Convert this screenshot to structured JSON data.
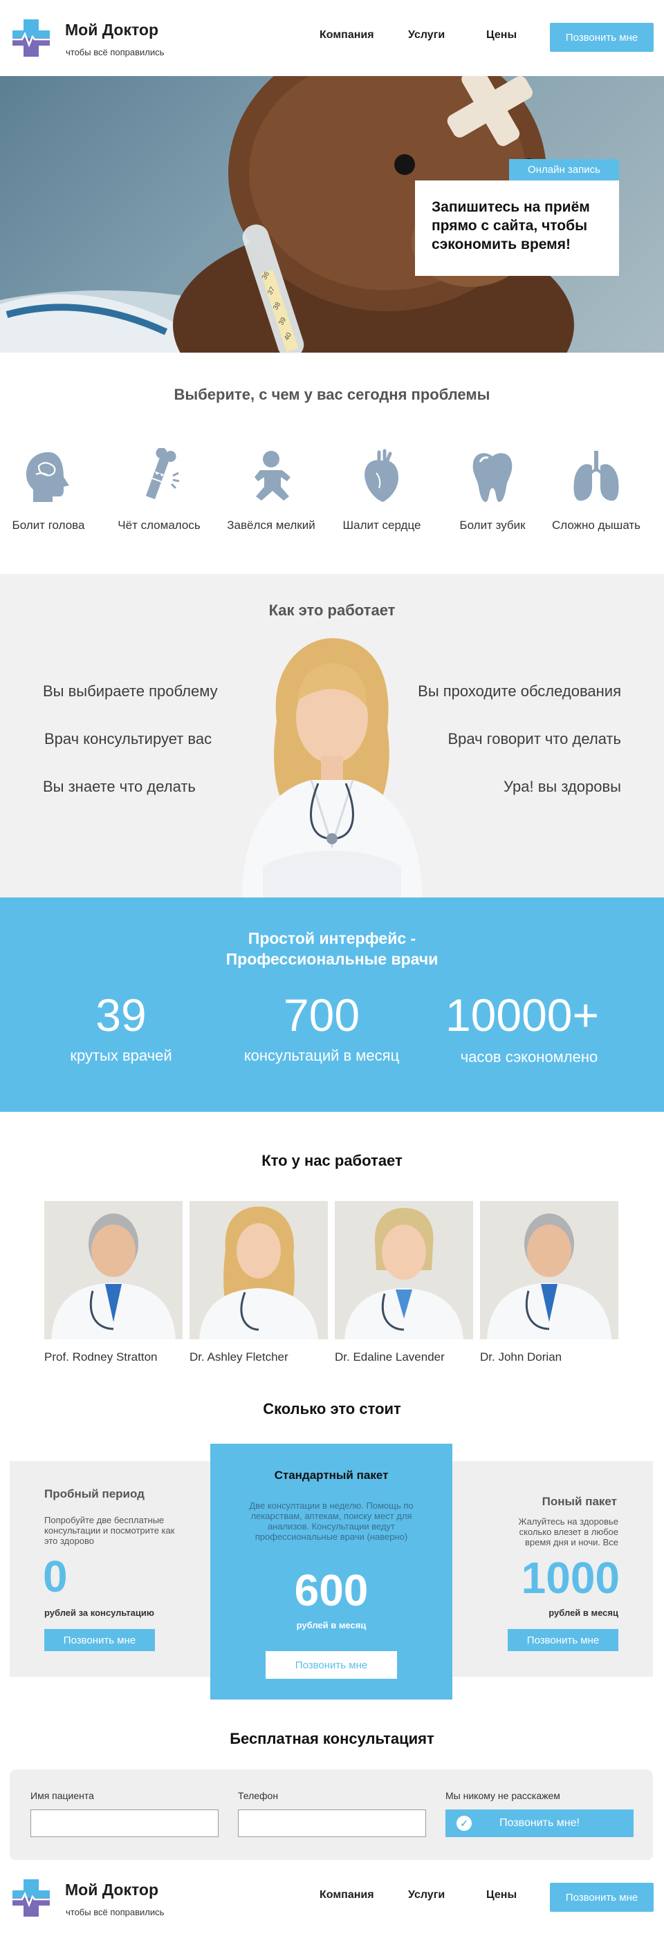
{
  "brand": {
    "name": "Мой Доктор",
    "tagline": "чтобы всё поправились"
  },
  "nav": {
    "items": [
      "Компания",
      "Услуги",
      "Цены"
    ],
    "call_label": "Позвонить мне"
  },
  "hero": {
    "tag": "Онлайн запись",
    "text": "Запишитесь на приём прямо с сайта, чтобы сэкономить время!",
    "thermometer_marks": [
      "36",
      "37",
      "38",
      "39",
      "40"
    ]
  },
  "problems": {
    "title": "Выберите, с чем у вас сегодня проблемы",
    "items": [
      {
        "label": "Болит голова",
        "icon": "head-icon"
      },
      {
        "label": "Чёт сломалось",
        "icon": "broken-bone-icon"
      },
      {
        "label": "Завёлся мелкий",
        "icon": "baby-icon"
      },
      {
        "label": "Шалит сердце",
        "icon": "heart-icon"
      },
      {
        "label": "Болит зубик",
        "icon": "tooth-icon"
      },
      {
        "label": "Сложно дышать",
        "icon": "lungs-icon"
      }
    ]
  },
  "how": {
    "title": "Как это работает",
    "left": [
      "Вы выбираете проблему",
      "Врач консультирует вас",
      "Вы знаете что делать"
    ],
    "right": [
      "Вы проходите обследования",
      "Врач говорит что делать",
      "Ура! вы здоровы"
    ]
  },
  "stats": {
    "title_line1": "Простой интерфейс -",
    "title_line2": "Профессиональные врачи",
    "items": [
      {
        "value": "39",
        "caption": "крутых врачей"
      },
      {
        "value": "700",
        "caption": "консультаций в месяц"
      },
      {
        "value": "10000+",
        "caption": "часов сэкономлено"
      }
    ]
  },
  "team": {
    "title": "Кто у нас работает",
    "doctors": [
      "Prof. Rodney Stratton",
      "Dr. Ashley Fletcher",
      "Dr. Edaline Lavender",
      "Dr. John Dorian"
    ]
  },
  "pricing": {
    "title": "Сколько это стоит",
    "plans": [
      {
        "name": "Пробный период",
        "desc": "Попробуйте две бесплатные консультации и посмотрите как это здорово",
        "price": "0",
        "unit": "рублей за консультацию",
        "button": "Позвонить мне"
      },
      {
        "name": "Стандартный пакет",
        "desc": "Две консултации в неделю. Помощь по лекарствам, аптекам, поиску мест для анализов. Консультации ведут профессиональные врачи (наверно)",
        "price": "600",
        "unit": "рублей в месяц",
        "button": "Позвонить мне"
      },
      {
        "name": "Поный пакет",
        "desc": "Жалуйтесь на здоровье сколько влезет в любое время дня и ночи. Все",
        "price": "1000",
        "unit": "рублей в месяц",
        "button": "Позвонить мне"
      }
    ]
  },
  "consult": {
    "title": "Бесплатная консультацият",
    "name_label": "Имя пациента",
    "name_value": "",
    "phone_label": "Телефон",
    "phone_value": "",
    "privacy": "Мы никому не расскажем",
    "submit": "Позвонить мне!"
  },
  "colors": {
    "accent": "#5dbde9",
    "icon": "#8fa6bc",
    "panel": "#efefef"
  }
}
